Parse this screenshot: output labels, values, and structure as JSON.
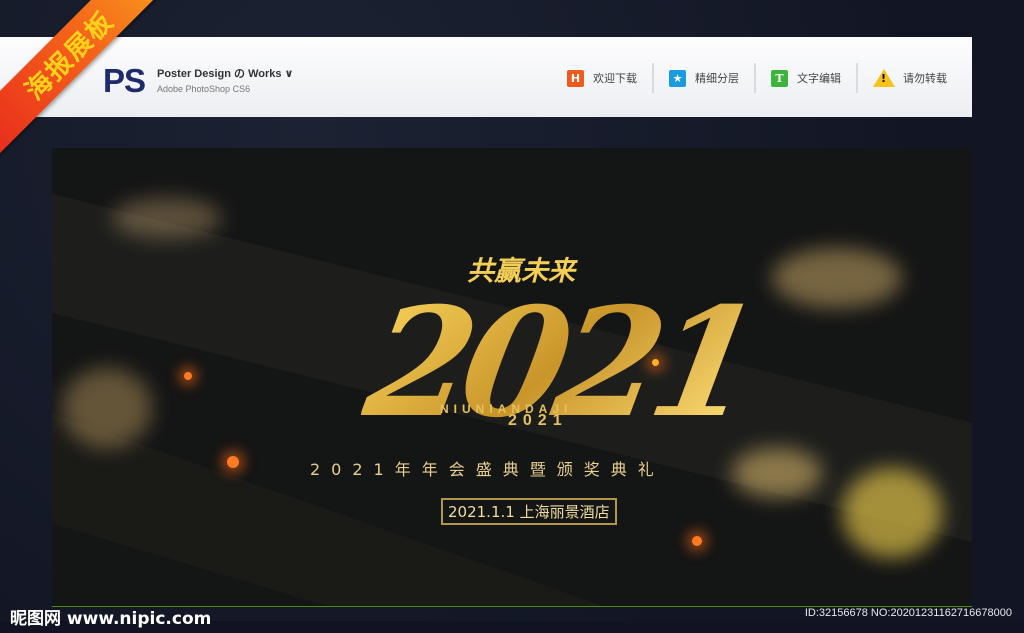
{
  "ribbon": "海报展板",
  "header": {
    "logo": "PS",
    "brand_title": "Poster Design の Works  ∨",
    "brand_subtitle": "Adobe PhotoShop CS6",
    "nav": [
      {
        "icon": "H",
        "label": "欢迎下载",
        "color": "#f05a1e"
      },
      {
        "icon": "★",
        "label": "精细分层",
        "color": "#1a9be0"
      },
      {
        "icon": "T",
        "label": "文字编辑",
        "color": "#3db53d"
      },
      {
        "icon": "!",
        "label": "请勿转载",
        "color": "#f7c21b"
      }
    ]
  },
  "poster": {
    "slogan": "共赢未来",
    "year_big": "2021",
    "pinyin": "NIUNIANDAJI",
    "year_small": "2021",
    "title": "2021年年会盛典暨颁奖典礼",
    "venue": "2021.1.1  上海丽景酒店"
  },
  "watermark": {
    "site": "昵图网 www.nipic.com",
    "id": "ID:32156678 NO:20201231162716678000"
  }
}
